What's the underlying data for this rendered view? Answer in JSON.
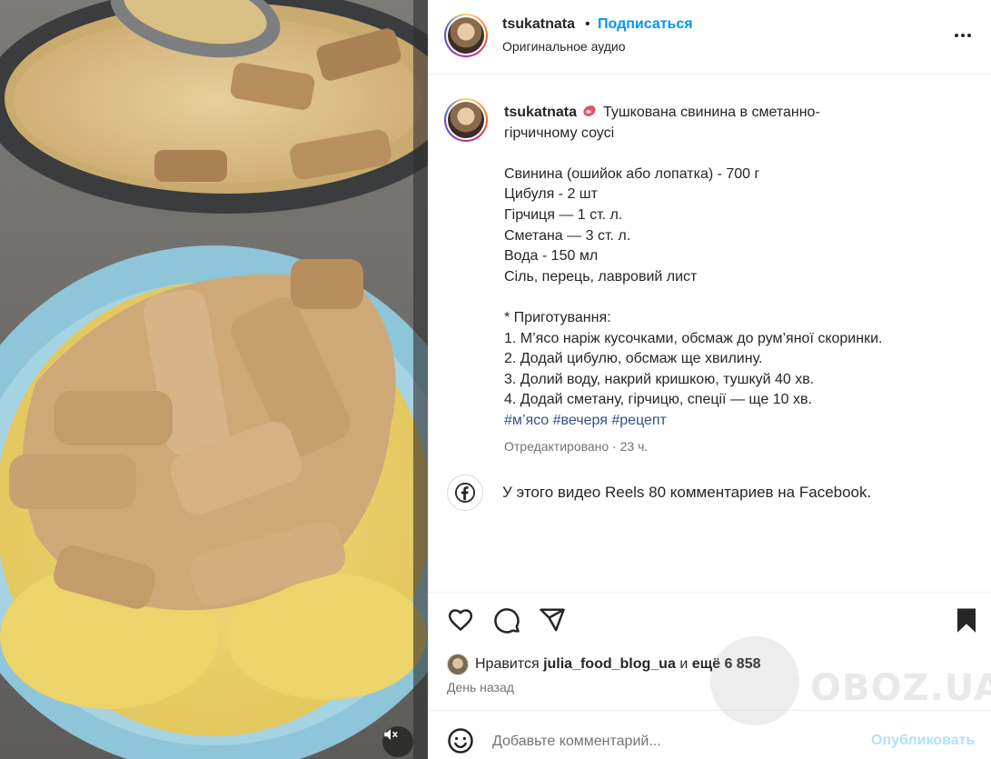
{
  "post": {
    "username": "tsukatnata",
    "separator": "•",
    "follow_label": "Подписаться",
    "audio": "Оригинальное аудио"
  },
  "caption": {
    "username": "tsukatnata",
    "emoji": "meat-emoji",
    "title_line1": "Тушкована свинина в сметанно-",
    "title_line2": "гірчичному соусі",
    "ingredients": [
      "Свинина (ошийок або лопатка) - 700 г",
      "Цибуля - 2 шт",
      "Гірчиця — 1 ст. л.",
      "Сметана — 3 ст. л.",
      "Вода - 150 мл",
      "Сіль, перець, лавровий лист"
    ],
    "steps_header": "* Приготування:",
    "steps": [
      "1. М’ясо наріж кусочками, обсмаж до рум’яної скоринки.",
      "2. Додай цибулю, обсмаж ще хвилину.",
      "3. Долий воду, накрий кришкою, тушкуй 40 хв.",
      "4. Додай сметану, гірчицю, спеції — ще 10 хв."
    ],
    "hashtags": [
      "#м’ясо",
      "#вечеря",
      "#рецепт"
    ],
    "edited": "Отредактировано · 23 ч."
  },
  "facebook": {
    "text": "У этого видео Reels 80 комментариев на Facebook."
  },
  "likes": {
    "prefix": "Нравится",
    "user": "julia_food_blog_ua",
    "middle": "и",
    "rest": "ещё 6 858",
    "time": "День назад"
  },
  "comment": {
    "placeholder": "Добавьте комментарий...",
    "post_label": "Опубликовать"
  },
  "watermark": {
    "text": "OBOZ.UA"
  },
  "colors": {
    "accent": "#0095f6",
    "hashtag": "#385185",
    "muted": "#737373",
    "post_disabled": "#b2dffc"
  },
  "icons": {
    "like": "heart-icon",
    "comment": "comment-icon",
    "share": "share-icon",
    "save": "bookmark-icon",
    "more": "more-icon",
    "emoji": "emoji-icon",
    "facebook": "facebook-icon",
    "mute": "speaker-muted-icon"
  }
}
